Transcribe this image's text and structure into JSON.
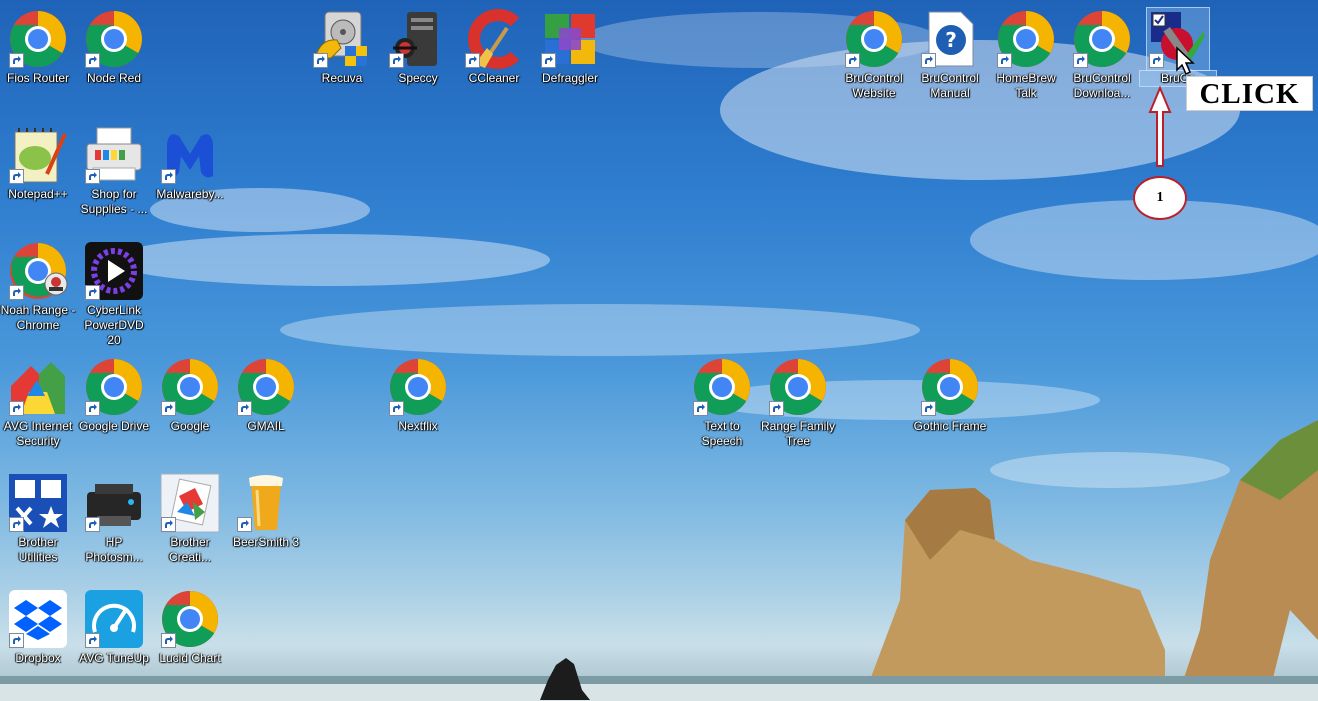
{
  "desktop": {
    "icons": [
      {
        "label": "Fios Router",
        "icon": "chrome-icon"
      },
      {
        "label": "Node Red",
        "icon": "chrome-icon"
      },
      {
        "label": "Recuva",
        "icon": "recuva-icon"
      },
      {
        "label": "Speccy",
        "icon": "speccy-icon"
      },
      {
        "label": "CCleaner",
        "icon": "ccleaner-icon"
      },
      {
        "label": "Defraggler",
        "icon": "defraggler-icon"
      },
      {
        "label": "BruControl Website",
        "icon": "chrome-icon"
      },
      {
        "label": "BruControl Manual",
        "icon": "help-icon"
      },
      {
        "label": "HomeBrew Talk",
        "icon": "chrome-icon"
      },
      {
        "label": "BruControl Downloa...",
        "icon": "chrome-icon"
      },
      {
        "label": "BruCo",
        "icon": "brucontrol-icon"
      },
      {
        "label": "Notepad++",
        "icon": "notepad-plus-plus-icon"
      },
      {
        "label": "Shop for Supplies - ...",
        "icon": "printer-icon"
      },
      {
        "label": "Malwareby...",
        "icon": "malwarebytes-icon"
      },
      {
        "label": "Noah Range - Chrome",
        "icon": "chrome-profile-icon"
      },
      {
        "label": "CyberLink PowerDVD 20",
        "icon": "powerdvd-icon"
      },
      {
        "label": "AVG Internet Security",
        "icon": "avg-icon"
      },
      {
        "label": "Google Drive",
        "icon": "chrome-icon"
      },
      {
        "label": "Google",
        "icon": "chrome-icon"
      },
      {
        "label": "GMAIL",
        "icon": "chrome-icon"
      },
      {
        "label": "Nextflix",
        "icon": "chrome-icon"
      },
      {
        "label": "Text to Speech",
        "icon": "chrome-icon"
      },
      {
        "label": "Range Family Tree",
        "icon": "chrome-icon"
      },
      {
        "label": "Gothic Frame",
        "icon": "chrome-icon"
      },
      {
        "label": "Brother Utilities",
        "icon": "brother-utilities-icon"
      },
      {
        "label": "HP Photosm...",
        "icon": "hp-printer-icon"
      },
      {
        "label": "Brother Creati...",
        "icon": "brother-creative-icon"
      },
      {
        "label": "BeerSmith 3",
        "icon": "beer-glass-icon"
      },
      {
        "label": "Dropbox",
        "icon": "dropbox-icon"
      },
      {
        "label": "AVG TuneUp",
        "icon": "avg-tuneup-icon"
      },
      {
        "label": "Lucid Chart",
        "icon": "chrome-icon"
      }
    ]
  },
  "annotation": {
    "callout_text": "CLICK",
    "step_number": "1"
  },
  "colors": {
    "callout_red": "#b8202a"
  }
}
